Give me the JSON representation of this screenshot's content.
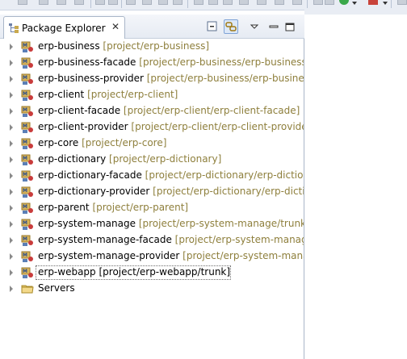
{
  "view": {
    "tab_title": "Package Explorer",
    "tab_close_glyph": "✕",
    "header_buttons": [
      "collapse-all-icon",
      "link-with-editor-icon",
      "view-menu-icon",
      "minimize-icon",
      "maximize-icon"
    ]
  },
  "tree": {
    "projects": [
      {
        "name": "erp-business",
        "path": "[project/erp-business]"
      },
      {
        "name": "erp-business-facade",
        "path": "[project/erp-business/erp-business"
      },
      {
        "name": "erp-business-provider",
        "path": "[project/erp-business/erp-busine"
      },
      {
        "name": "erp-client",
        "path": "[project/erp-client]"
      },
      {
        "name": "erp-client-facade",
        "path": "[project/erp-client/erp-client-facade]"
      },
      {
        "name": "erp-client-provider",
        "path": "[project/erp-client/erp-client-provide"
      },
      {
        "name": "erp-core",
        "path": "[project/erp-core]"
      },
      {
        "name": "erp-dictionary",
        "path": "[project/erp-dictionary]"
      },
      {
        "name": "erp-dictionary-facade",
        "path": "[project/erp-dictionary/erp-diction"
      },
      {
        "name": "erp-dictionary-provider",
        "path": "[project/erp-dictionary/erp-dicti"
      },
      {
        "name": "erp-parent",
        "path": "[project/erp-parent]"
      },
      {
        "name": "erp-system-manage",
        "path": "[project/erp-system-manage/trunk]"
      },
      {
        "name": "erp-system-manage-facade",
        "path": "[project/erp-system-manage"
      },
      {
        "name": "erp-system-manage-provider",
        "path": "[project/erp-system-mana"
      },
      {
        "name": "erp-webapp",
        "path": "[project/erp-webapp/trunk]",
        "selected": true
      }
    ],
    "servers": {
      "name": "Servers"
    }
  },
  "colors": {
    "path_decoration": "#8e7f3c",
    "accent": "#7fa3d6"
  }
}
